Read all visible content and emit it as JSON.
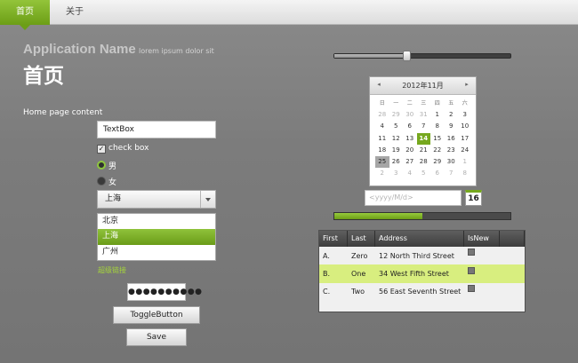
{
  "nav": {
    "tabs": [
      {
        "label": "首页",
        "active": true
      },
      {
        "label": "关于",
        "active": false
      }
    ]
  },
  "header": {
    "app_name": "Application Name",
    "subtitle": "lorem ipsum dolor sit",
    "page_title": "首页"
  },
  "content": {
    "label": "Home page content",
    "textbox_value": "TextBox",
    "checkbox": {
      "label": "check box",
      "checked": true
    },
    "radios": [
      {
        "label": "男",
        "checked": true
      },
      {
        "label": "女",
        "checked": false
      }
    ],
    "combo": {
      "selected": "上海"
    },
    "listbox": {
      "items": [
        "北京",
        "上海",
        "广州"
      ],
      "selected_index": 1
    },
    "hyperlink": "超级链接",
    "password_value": "●●●●●●●●●●",
    "toggle_button": "ToggleButton",
    "save_button": "Save"
  },
  "slider": {
    "value": 0.41
  },
  "calendar": {
    "title": "2012年11月",
    "prev_glyph": "◂",
    "next_glyph": "▸",
    "weekdays": [
      "日",
      "一",
      "二",
      "三",
      "四",
      "五",
      "六"
    ],
    "weeks": [
      [
        "28",
        "29",
        "30",
        "31",
        "1",
        "2",
        "3"
      ],
      [
        "4",
        "5",
        "6",
        "7",
        "8",
        "9",
        "10"
      ],
      [
        "11",
        "12",
        "13",
        "14",
        "15",
        "16",
        "17"
      ],
      [
        "18",
        "19",
        "20",
        "21",
        "22",
        "23",
        "24"
      ],
      [
        "25",
        "26",
        "27",
        "28",
        "29",
        "30",
        "1"
      ],
      [
        "2",
        "3",
        "4",
        "5",
        "6",
        "7",
        "8"
      ]
    ],
    "today": "14",
    "selected": "25"
  },
  "datepicker": {
    "placeholder": "<yyyy/M/d>",
    "icon_day": "16"
  },
  "progress": {
    "value": 0.5
  },
  "datagrid": {
    "columns": [
      "First",
      "Last",
      "Address",
      "IsNew"
    ],
    "rows": [
      {
        "first": "A.",
        "last": "Zero",
        "address": "12 North Third Street",
        "isnew": true
      },
      {
        "first": "B.",
        "last": "One",
        "address": "34 West Fifth Street",
        "isnew": true
      },
      {
        "first": "C.",
        "last": "Two",
        "address": "56 East Seventh Street",
        "isnew": true
      }
    ]
  },
  "colors": {
    "accent": "#76a81e",
    "row_highlight": "#d8ee7f",
    "link": "#a5d43b"
  }
}
